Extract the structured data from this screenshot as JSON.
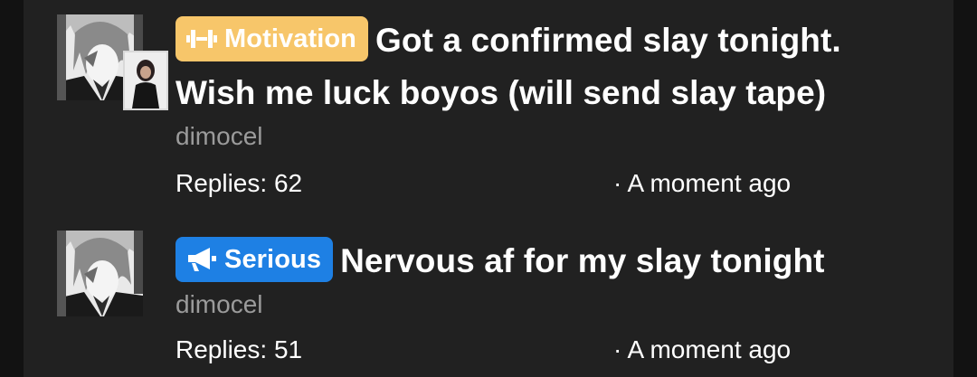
{
  "threads": [
    {
      "badge": {
        "label": "Motivation",
        "icon": "dumbbell-icon",
        "color": "#f7c66a"
      },
      "title": "Got a confirmed slay tonight. Wish me luck boyos (will send slay tape)",
      "author": "dimocel",
      "replies_text": "Replies: 62",
      "time_text": "· A moment ago"
    },
    {
      "badge": {
        "label": "Serious",
        "icon": "megaphone-icon",
        "color": "#1e80e4"
      },
      "title": "Nervous af for my slay tonight",
      "author": "dimocel",
      "replies_text": "Replies: 51",
      "time_text": "· A moment ago"
    }
  ]
}
